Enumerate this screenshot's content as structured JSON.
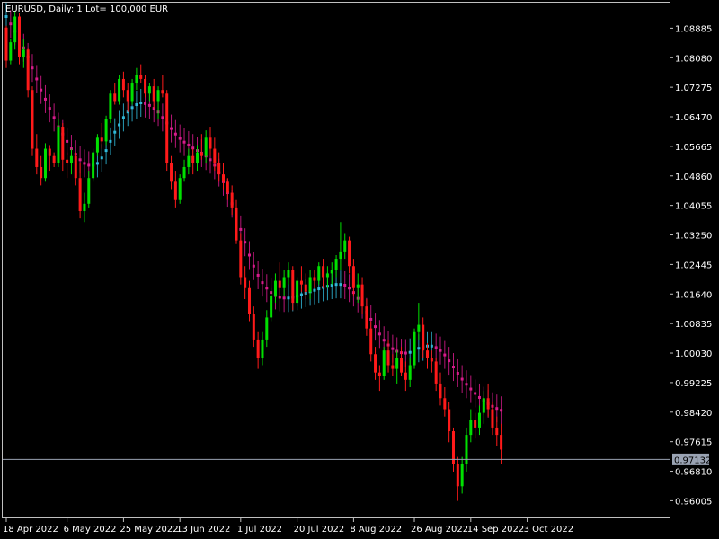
{
  "window": {
    "title": "EURUSD, Daily:  1 Lot= 100,000 EUR"
  },
  "price_tag": {
    "label": "0.97132",
    "value": 0.97132
  },
  "colors": {
    "background": "#000000",
    "frame": "#c0c0c0",
    "bull_candle": "#00e000",
    "bear_candle": "#ff1a1a",
    "band_down": "#d81b8c",
    "band_up": "#30b8d8",
    "price_line": "#9aa3b3",
    "price_tag_bg": "#9aa3b3",
    "text": "#ffffff"
  },
  "chart_data": {
    "type": "candlestick",
    "symbol": "EURUSD",
    "timeframe": "Daily",
    "ylim": [
      0.9555,
      1.0958
    ],
    "y_ticks": [
      "1.08885",
      "1.08080",
      "1.07275",
      "1.06470",
      "1.05665",
      "1.04860",
      "1.04055",
      "1.03250",
      "1.02445",
      "1.01640",
      "1.00835",
      "1.00030",
      "0.99225",
      "0.98420",
      "0.97615",
      "0.96810",
      "0.96005"
    ],
    "x_ticks": [
      {
        "label": "18 Apr 2022",
        "index": 0
      },
      {
        "label": "6 May 2022",
        "index": 14
      },
      {
        "label": "25 May 2022",
        "index": 27
      },
      {
        "label": "13 Jun 2022",
        "index": 40
      },
      {
        "label": "1 Jul 2022",
        "index": 54
      },
      {
        "label": "20 Jul 2022",
        "index": 67
      },
      {
        "label": "8 Aug 2022",
        "index": 80
      },
      {
        "label": "26 Aug 2022",
        "index": 94
      },
      {
        "label": "14 Sep 2022",
        "index": 107
      },
      {
        "label": "3 Oct 2022",
        "index": 120
      }
    ],
    "candles": [
      [
        1.089,
        1.0895,
        1.078,
        1.08
      ],
      [
        1.08,
        1.086,
        1.079,
        1.085
      ],
      [
        1.085,
        1.0935,
        1.083,
        1.092
      ],
      [
        1.092,
        1.093,
        1.079,
        1.081
      ],
      [
        1.081,
        1.086,
        1.078,
        1.083
      ],
      [
        1.083,
        1.0835,
        1.07,
        1.072
      ],
      [
        1.072,
        1.073,
        1.054,
        1.056
      ],
      [
        1.056,
        1.06,
        1.049,
        1.051
      ],
      [
        1.051,
        1.054,
        1.046,
        1.048
      ],
      [
        1.048,
        1.0575,
        1.047,
        1.056
      ],
      [
        1.056,
        1.057,
        1.05,
        1.054
      ],
      [
        1.054,
        1.055,
        1.051,
        1.052
      ],
      [
        1.052,
        1.064,
        1.051,
        1.062
      ],
      [
        1.062,
        1.063,
        1.05,
        1.053
      ],
      [
        1.053,
        1.055,
        1.048,
        1.052
      ],
      [
        1.052,
        1.056,
        1.049,
        1.054
      ],
      [
        1.054,
        1.055,
        1.046,
        1.048
      ],
      [
        1.048,
        1.052,
        1.037,
        1.039
      ],
      [
        1.039,
        1.044,
        1.036,
        1.041
      ],
      [
        1.041,
        1.05,
        1.04,
        1.048
      ],
      [
        1.048,
        1.056,
        1.047,
        1.055
      ],
      [
        1.055,
        1.06,
        1.054,
        1.059
      ],
      [
        1.059,
        1.063,
        1.056,
        1.058
      ],
      [
        1.058,
        1.065,
        1.057,
        1.064
      ],
      [
        1.064,
        1.072,
        1.063,
        1.071
      ],
      [
        1.071,
        1.074,
        1.068,
        1.069
      ],
      [
        1.069,
        1.076,
        1.068,
        1.075
      ],
      [
        1.075,
        1.077,
        1.07,
        1.072
      ],
      [
        1.072,
        1.074,
        1.066,
        1.069
      ],
      [
        1.069,
        1.075,
        1.068,
        1.074
      ],
      [
        1.074,
        1.078,
        1.072,
        1.076
      ],
      [
        1.076,
        1.079,
        1.074,
        1.075
      ],
      [
        1.075,
        1.076,
        1.07,
        1.071
      ],
      [
        1.071,
        1.074,
        1.069,
        1.073
      ],
      [
        1.073,
        1.075,
        1.067,
        1.069
      ],
      [
        1.069,
        1.073,
        1.064,
        1.072
      ],
      [
        1.072,
        1.076,
        1.07,
        1.071
      ],
      [
        1.071,
        1.072,
        1.05,
        1.052
      ],
      [
        1.052,
        1.054,
        1.045,
        1.047
      ],
      [
        1.047,
        1.05,
        1.04,
        1.042
      ],
      [
        1.042,
        1.049,
        1.041,
        1.048
      ],
      [
        1.048,
        1.053,
        1.047,
        1.051
      ],
      [
        1.051,
        1.056,
        1.049,
        1.054
      ],
      [
        1.054,
        1.056,
        1.049,
        1.052
      ],
      [
        1.052,
        1.057,
        1.05,
        1.055
      ],
      [
        1.055,
        1.06,
        1.053,
        1.054
      ],
      [
        1.054,
        1.061,
        1.052,
        1.059
      ],
      [
        1.059,
        1.062,
        1.054,
        1.056
      ],
      [
        1.056,
        1.059,
        1.05,
        1.052
      ],
      [
        1.052,
        1.055,
        1.047,
        1.049
      ],
      [
        1.049,
        1.052,
        1.045,
        1.047
      ],
      [
        1.047,
        1.048,
        1.042,
        1.044
      ],
      [
        1.044,
        1.046,
        1.038,
        1.04
      ],
      [
        1.04,
        1.042,
        1.03,
        1.031
      ],
      [
        1.031,
        1.033,
        1.019,
        1.021
      ],
      [
        1.021,
        1.024,
        1.015,
        1.018
      ],
      [
        1.018,
        1.02,
        1.009,
        1.011
      ],
      [
        1.011,
        1.013,
        1.002,
        1.004
      ],
      [
        1.004,
        1.006,
        0.996,
        0.999
      ],
      [
        0.999,
        1.006,
        0.997,
        1.004
      ],
      [
        1.004,
        1.012,
        1.002,
        1.01
      ],
      [
        1.01,
        1.018,
        1.009,
        1.016
      ],
      [
        1.016,
        1.022,
        1.014,
        1.02
      ],
      [
        1.02,
        1.025,
        1.015,
        1.018
      ],
      [
        1.018,
        1.023,
        1.016,
        1.021
      ],
      [
        1.021,
        1.025,
        1.019,
        1.023
      ],
      [
        1.023,
        1.024,
        1.012,
        1.014
      ],
      [
        1.014,
        1.021,
        1.013,
        1.02
      ],
      [
        1.02,
        1.024,
        1.017,
        1.019
      ],
      [
        1.019,
        1.022,
        1.015,
        1.017
      ],
      [
        1.017,
        1.023,
        1.015,
        1.021
      ],
      [
        1.021,
        1.023,
        1.018,
        1.02
      ],
      [
        1.02,
        1.025,
        1.019,
        1.024
      ],
      [
        1.024,
        1.026,
        1.018,
        1.021
      ],
      [
        1.021,
        1.024,
        1.018,
        1.022
      ],
      [
        1.022,
        1.025,
        1.019,
        1.023
      ],
      [
        1.023,
        1.027,
        1.021,
        1.026
      ],
      [
        1.026,
        1.036,
        1.023,
        1.028
      ],
      [
        1.028,
        1.033,
        1.026,
        1.031
      ],
      [
        1.031,
        1.032,
        1.022,
        1.024
      ],
      [
        1.024,
        1.026,
        1.016,
        1.018
      ],
      [
        1.018,
        1.022,
        1.014,
        1.019
      ],
      [
        1.019,
        1.021,
        1.011,
        1.013
      ],
      [
        1.013,
        1.015,
        1.005,
        1.007
      ],
      [
        1.007,
        1.009,
        0.998,
        1.0
      ],
      [
        1.0,
        1.002,
        0.993,
        0.995
      ],
      [
        0.995,
        0.997,
        0.99,
        0.994
      ],
      [
        0.994,
        1.002,
        0.993,
        1.001
      ],
      [
        1.001,
        1.004,
        0.995,
        0.997
      ],
      [
        0.997,
        1.0,
        0.994,
        0.996
      ],
      [
        0.996,
        1.001,
        0.992,
        0.999
      ],
      [
        0.999,
        1.002,
        0.994,
        0.995
      ],
      [
        0.995,
        0.998,
        0.99,
        0.993
      ],
      [
        0.993,
        0.999,
        0.991,
        0.997
      ],
      [
        0.997,
        1.007,
        0.996,
        1.006
      ],
      [
        1.006,
        1.014,
        1.004,
        1.008
      ],
      [
        1.008,
        1.01,
        0.999,
        1.001
      ],
      [
        1.001,
        1.003,
        0.996,
        0.999
      ],
      [
        0.999,
        1.001,
        0.995,
        0.998
      ],
      [
        0.998,
        0.999,
        0.99,
        0.992
      ],
      [
        0.992,
        0.995,
        0.986,
        0.988
      ],
      [
        0.988,
        0.991,
        0.983,
        0.985
      ],
      [
        0.985,
        0.987,
        0.976,
        0.979
      ],
      [
        0.979,
        0.98,
        0.968,
        0.97
      ],
      [
        0.97,
        0.972,
        0.96,
        0.964
      ],
      [
        0.964,
        0.972,
        0.962,
        0.97
      ],
      [
        0.97,
        0.98,
        0.968,
        0.978
      ],
      [
        0.978,
        0.985,
        0.976,
        0.982
      ],
      [
        0.982,
        0.984,
        0.977,
        0.98
      ],
      [
        0.98,
        0.986,
        0.978,
        0.984
      ],
      [
        0.984,
        0.99,
        0.981,
        0.988
      ],
      [
        0.988,
        0.992,
        0.983,
        0.985
      ],
      [
        0.985,
        0.987,
        0.978,
        0.98
      ],
      [
        0.98,
        0.983,
        0.975,
        0.978
      ],
      [
        0.978,
        0.981,
        0.97,
        0.974
      ]
    ],
    "band": [
      1.092,
      1.09,
      1.088,
      1.086,
      1.0835,
      1.081,
      1.078,
      1.075,
      1.072,
      1.0695,
      1.067,
      1.0645,
      1.062,
      1.06,
      1.058,
      1.056,
      1.0545,
      1.053,
      1.052,
      1.0515,
      1.0515,
      1.052,
      1.0535,
      1.0555,
      1.058,
      1.0605,
      1.0625,
      1.0645,
      1.066,
      1.0672,
      1.068,
      1.0685,
      1.0683,
      1.0678,
      1.067,
      1.066,
      1.0645,
      1.063,
      1.0615,
      1.06,
      1.0588,
      1.0578,
      1.057,
      1.0562,
      1.0555,
      1.0548,
      1.054,
      1.053,
      1.0515,
      1.0495,
      1.047,
      1.044,
      1.041,
      1.0375,
      1.034,
      1.0305,
      1.027,
      1.024,
      1.0215,
      1.0195,
      1.018,
      1.0168,
      1.016,
      1.0155,
      1.0153,
      1.0153,
      1.0155,
      1.0158,
      1.0162,
      1.0166,
      1.017,
      1.0174,
      1.0178,
      1.0182,
      1.0185,
      1.0188,
      1.019,
      1.019,
      1.0188,
      1.018,
      1.0168,
      1.0152,
      1.0135,
      1.0115,
      1.0095,
      1.0075,
      1.0055,
      1.0038,
      1.0025,
      1.0015,
      1.0008,
      1.0004,
      1.0003,
      1.0005,
      1.001,
      1.0016,
      1.002,
      1.0022,
      1.0022,
      1.0018,
      1.001,
      0.9998,
      0.9982,
      0.9965,
      0.9948,
      0.9932,
      0.9918,
      0.9905,
      0.9893,
      0.9882,
      0.9873,
      0.9865,
      0.9858,
      0.9852,
      0.9847
    ],
    "band_halfwidth": 0.0038,
    "current_price": 0.97132
  }
}
